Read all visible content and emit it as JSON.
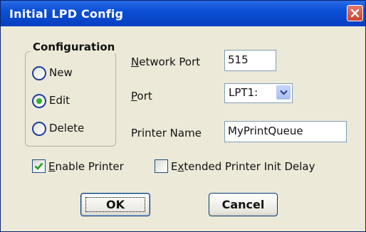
{
  "window": {
    "title": "Initial LPD Config"
  },
  "configuration": {
    "title": "Configuration",
    "options": [
      {
        "label": "New",
        "selected": false
      },
      {
        "label": "Edit",
        "selected": true
      },
      {
        "label": "Delete",
        "selected": false
      }
    ]
  },
  "fields": {
    "network_port": {
      "label_mnemonic": "N",
      "label_rest": "etwork Port",
      "value": "515"
    },
    "port": {
      "label_mnemonic": "P",
      "label_rest": "ort",
      "value": "LPT1:"
    },
    "printer_name": {
      "label": "Printer Name",
      "value": "MyPrintQueue"
    }
  },
  "checkboxes": {
    "enable_printer": {
      "label_mnemonic": "E",
      "label_rest": "nable Printer",
      "checked": true
    },
    "extended_delay": {
      "label_pre": "E",
      "label_mnemonic": "x",
      "label_rest": "tended Printer Init Delay",
      "checked": false
    }
  },
  "buttons": {
    "ok": "OK",
    "cancel": "Cancel"
  },
  "colors": {
    "titlebar": "#0b4fd6",
    "close": "#c9452d",
    "radio_selected": "#2fb32f",
    "check": "#21a121",
    "face": "#ece9d8"
  },
  "icons": {
    "close": "close-x-icon",
    "dropdown": "chevron-down-icon",
    "checkmark": "checkmark-icon"
  }
}
